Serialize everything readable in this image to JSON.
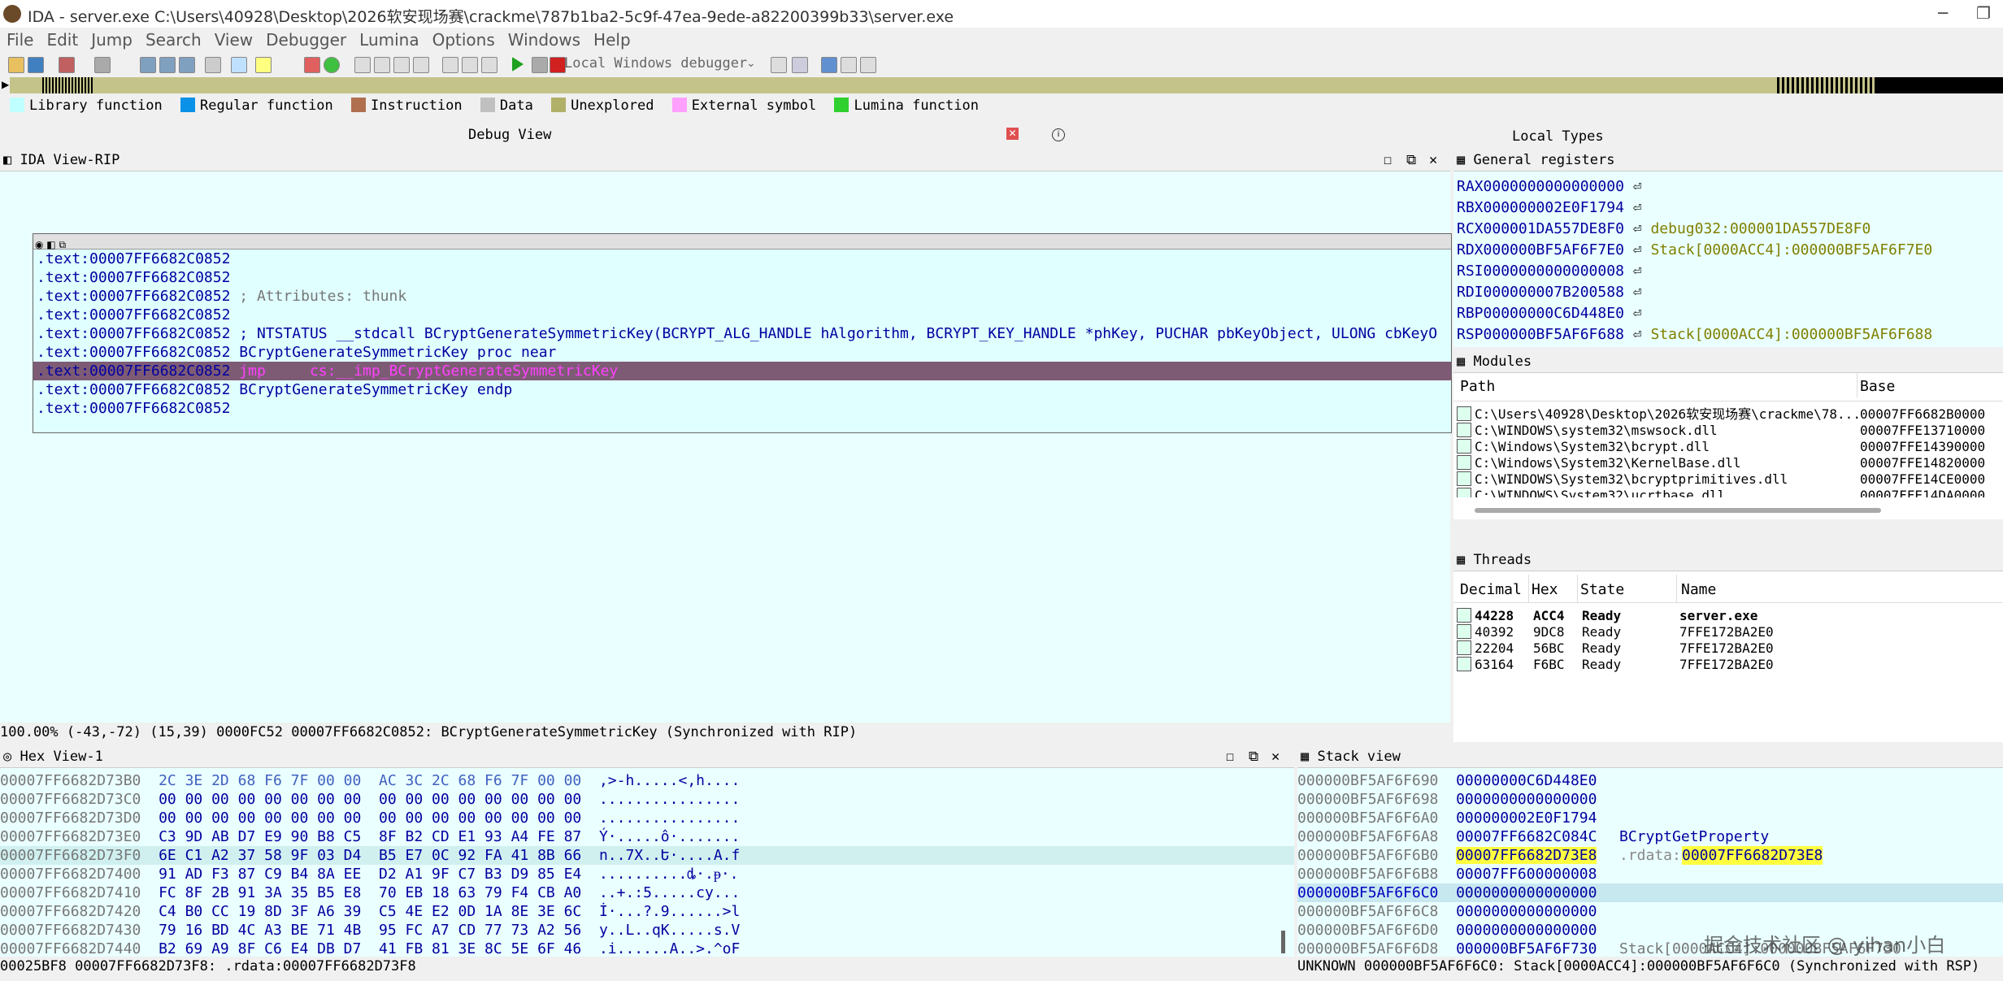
{
  "window": {
    "title": "IDA - server.exe C:\\Users\\40928\\Desktop\\2026软安现场赛\\crackme\\787b1ba2-5c9f-47ea-9ede-a82200399b33\\server.exe"
  },
  "menu": [
    "File",
    "Edit",
    "Jump",
    "Search",
    "View",
    "Debugger",
    "Lumina",
    "Options",
    "Windows",
    "Help"
  ],
  "toolbar": {
    "debugger": "Local Windows debugger"
  },
  "legend": [
    {
      "label": "Library function",
      "color": "#c0ffff"
    },
    {
      "label": "Regular function",
      "color": "#0a91e8"
    },
    {
      "label": "Instruction",
      "color": "#b07050"
    },
    {
      "label": "Data",
      "color": "#c0c0c0"
    },
    {
      "label": "Unexplored",
      "color": "#b0b068"
    },
    {
      "label": "External symbol",
      "color": "#ffa0ff"
    },
    {
      "label": "Lumina function",
      "color": "#30d030"
    }
  ],
  "tabs": {
    "debug_view": "Debug View",
    "local_types": "Local Types"
  },
  "ida_view": {
    "title": "IDA View-RIP",
    "lines": [
      {
        "addr": ".text:00007FF6682C0852",
        "text": ""
      },
      {
        "addr": ".text:00007FF6682C0852",
        "text": ""
      },
      {
        "addr": ".text:00007FF6682C0852",
        "text": "; Attributes: thunk"
      },
      {
        "addr": ".text:00007FF6682C0852",
        "text": ""
      },
      {
        "addr": ".text:00007FF6682C0852",
        "text": "; NTSTATUS __stdcall BCryptGenerateSymmetricKey(BCRYPT_ALG_HANDLE hAlgorithm, BCRYPT_KEY_HANDLE *phKey, PUCHAR pbKeyObject, ULONG cbKeyO"
      },
      {
        "addr": ".text:00007FF6682C0852",
        "text": "BCryptGenerateSymmetricKey proc near"
      },
      {
        "addr": ".text:00007FF6682C0852",
        "text": "jmp     cs:__imp_BCryptGenerateSymmetricKey"
      },
      {
        "addr": ".text:00007FF6682C0852",
        "text": "BCryptGenerateSymmetricKey endp"
      },
      {
        "addr": ".text:00007FF6682C0852",
        "text": ""
      }
    ],
    "status": "100.00% (-43,-72) (15,39) 0000FC52 00007FF6682C0852: BCryptGenerateSymmetricKey (Synchronized with RIP)"
  },
  "registers": {
    "title": "General registers",
    "rows": [
      {
        "name": "RAX",
        "value": "0000000000000000",
        "note": ""
      },
      {
        "name": "RBX",
        "value": "000000002E0F1794",
        "note": ""
      },
      {
        "name": "RCX",
        "value": "000001DA557DE8F0",
        "note": "debug032:000001DA557DE8F0"
      },
      {
        "name": "RDX",
        "value": "000000BF5AF6F7E0",
        "note": "Stack[0000ACC4]:000000BF5AF6F7E0"
      },
      {
        "name": "RSI",
        "value": "0000000000000008",
        "note": ""
      },
      {
        "name": "RDI",
        "value": "000000007B200588",
        "note": ""
      },
      {
        "name": "RBP",
        "value": "00000000C6D448E0",
        "note": ""
      },
      {
        "name": "RSP",
        "value": "000000BF5AF6F688",
        "note": "Stack[0000ACC4]:000000BF5AF6F688"
      }
    ]
  },
  "modules": {
    "title": "Modules",
    "headers": {
      "path": "Path",
      "base": "Base"
    },
    "rows": [
      {
        "path": "C:\\Users\\40928\\Desktop\\2026软安现场赛\\crackme\\78...",
        "base": "00007FF6682B0000"
      },
      {
        "path": "C:\\WINDOWS\\system32\\mswsock.dll",
        "base": "00007FFE13710000"
      },
      {
        "path": "C:\\Windows\\System32\\bcrypt.dll",
        "base": "00007FFE14390000"
      },
      {
        "path": "C:\\Windows\\System32\\KernelBase.dll",
        "base": "00007FFE14820000"
      },
      {
        "path": "C:\\WINDOWS\\System32\\bcryptprimitives.dll",
        "base": "00007FFE14CE0000"
      },
      {
        "path": "C:\\WINDOWS\\System32\\ucrtbase.dll",
        "base": "00007FFE14DA0000"
      }
    ]
  },
  "threads": {
    "title": "Threads",
    "headers": {
      "decimal": "Decimal",
      "hex": "Hex",
      "state": "State",
      "name": "Name"
    },
    "rows": [
      {
        "decimal": "44228",
        "hex": "ACC4",
        "state": "Ready",
        "name": "server.exe"
      },
      {
        "decimal": "40392",
        "hex": "9DC8",
        "state": "Ready",
        "name": "7FFE172BA2E0"
      },
      {
        "decimal": "22204",
        "hex": "56BC",
        "state": "Ready",
        "name": "7FFE172BA2E0"
      },
      {
        "decimal": "63164",
        "hex": "F6BC",
        "state": "Ready",
        "name": "7FFE172BA2E0"
      }
    ]
  },
  "hex_view": {
    "title": "Hex View-1",
    "rows": [
      {
        "addr": "00007FF6682D73B0",
        "bytes1": "2C 3E 2D 68 F6 7F 00 00",
        "bytes2": "AC 3C 2C 68 F6 7F 00 00",
        "ascii": ",>-h.....<,h...."
      },
      {
        "addr": "00007FF6682D73C0",
        "bytes1": "00 00 00 00 00 00 00 00",
        "bytes2": "00 00 00 00 00 00 00 00",
        "ascii": "................"
      },
      {
        "addr": "00007FF6682D73D0",
        "bytes1": "00 00 00 00 00 00 00 00",
        "bytes2": "00 00 00 00 00 00 00 00",
        "ascii": "................"
      },
      {
        "addr": "00007FF6682D73E0",
        "bytes1": "C3 9D AB D7 E9 90 B8 C5",
        "bytes2": "8F B2 CD E1 93 A4 FE 87",
        "ascii": "Ý·.....ô·......."
      },
      {
        "addr": "00007FF6682D73F0",
        "bytes1": "6E C1 A2 37 58 9F 03 D4",
        "bytes2": "B5 E7 0C 92 FA 41 8B 66",
        "ascii": "n..7X..Ե·....A.f"
      },
      {
        "addr": "00007FF6682D7400",
        "bytes1": "91 AD F3 87 C9 B4 8A EE",
        "bytes2": "D2 A1 9F C7 B3 D9 85 E4",
        "ascii": "..........ȡ·.ᵽ·."
      },
      {
        "addr": "00007FF6682D7410",
        "bytes1": "FC 8F 2B 91 3A 35 B5 E8",
        "bytes2": "70 EB 18 63 79 F4 CB A0",
        "ascii": "..+.:5.....cy..."
      },
      {
        "addr": "00007FF6682D7420",
        "bytes1": "C4 B0 CC 19 8D 3F A6 39",
        "bytes2": "C5 4E E2 0D 1A 8E 3E 6C",
        "ascii": "İ·...?.9......>l"
      },
      {
        "addr": "00007FF6682D7430",
        "bytes1": "79 16 BD 4C A3 BE 71 4B",
        "bytes2": "95 FC A7 CD 77 73 A2 56",
        "ascii": "y..L..qK.....s.V"
      },
      {
        "addr": "00007FF6682D7440",
        "bytes1": "B2 69 A9 8F C6 E4 DB D7",
        "bytes2": "41 FB 81 3E 8C 5E 6F 46",
        "ascii": ".i......A..>.^oF"
      }
    ],
    "status": "00025BF8 00007FF6682D73F8: .rdata:00007FF6682D73F8"
  },
  "stack_view": {
    "title": "Stack view",
    "rows": [
      {
        "addr": "000000BF5AF6F690",
        "value": "00000000C6D448E0",
        "note": ""
      },
      {
        "addr": "000000BF5AF6F698",
        "value": "0000000000000000",
        "note": ""
      },
      {
        "addr": "000000BF5AF6F6A0",
        "value": "000000002E0F1794",
        "note": ""
      },
      {
        "addr": "000000BF5AF6F6A8",
        "value": "00007FF6682C084C",
        "note": "BCryptGetProperty"
      },
      {
        "addr": "000000BF5AF6F6B0",
        "value": "00007FF6682D73E8",
        "note": ".rdata:00007FF6682D73E8"
      },
      {
        "addr": "000000BF5AF6F6B8",
        "value": "00007FF600000008",
        "note": ""
      },
      {
        "addr": "000000BF5AF6F6C0",
        "value": "0000000000000000",
        "note": ""
      },
      {
        "addr": "000000BF5AF6F6C8",
        "value": "0000000000000000",
        "note": ""
      },
      {
        "addr": "000000BF5AF6F6D0",
        "value": "0000000000000000",
        "note": ""
      },
      {
        "addr": "000000BF5AF6F6D8",
        "value": "000000BF5AF6F730",
        "note": "Stack[0000ACC4]:000000BF5AF6F730"
      }
    ],
    "status": "UNKNOWN 000000BF5AF6F6C0: Stack[0000ACC4]:000000BF5AF6F6C0 (Synchronized with RSP)"
  },
  "watermark": "掘金技术社区 @ yihan小白"
}
